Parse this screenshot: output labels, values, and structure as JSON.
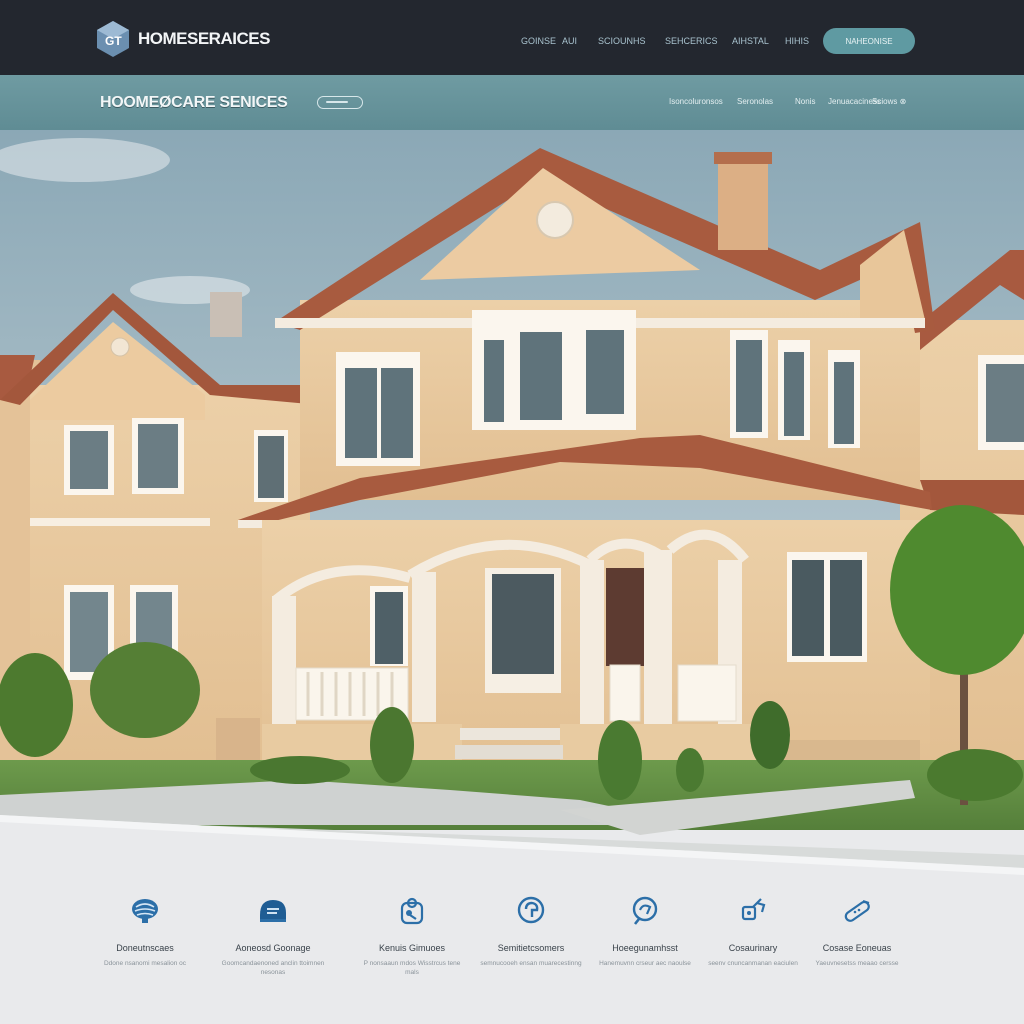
{
  "header": {
    "logo_text": "HOMESERAICES",
    "nav": [
      "GOINSE",
      "AUI",
      "SCIOUNHS",
      "SEHCERICS",
      "AIHSTAL",
      "HIHIS"
    ],
    "cta_label": "NAHEONISE"
  },
  "subheader": {
    "title": "HOOMEØCARE SENICES",
    "nav": [
      "Isoncoluronsos",
      "Seronolas",
      "Nonis",
      "Jenuacaciness",
      "Sciows ⊗"
    ]
  },
  "features": [
    {
      "icon": "brain-icon",
      "title": "Doneutnscaes",
      "desc": "Ddone nsanomi mesalion oc"
    },
    {
      "icon": "helmet-icon",
      "title": "Aoneosd Goonage",
      "desc": "Goomcandaenoned anclin ttoimnen nesonas"
    },
    {
      "icon": "hand-care-icon",
      "title": "Kenuis Gimuoes",
      "desc": "P nonsaaun mdos Wisstrcus tene mals"
    },
    {
      "icon": "ear-icon",
      "title": "Semitietcsomers",
      "desc": "semnucooeh ensan muarecestinng"
    },
    {
      "icon": "medical-search-icon",
      "title": "Hoeegunamhsst",
      "desc": "Hanemuvnn crseur aec naoulse"
    },
    {
      "icon": "tools-icon",
      "title": "Cosaurinary",
      "desc": "seenv cnuncanmanan eaciulen"
    },
    {
      "icon": "bandage-icon",
      "title": "Cosase Eoneuas",
      "desc": "Yaeuvnesetss meaao cersse"
    }
  ],
  "colors": {
    "topbar": "#23272f",
    "accent": "#5f9aa2",
    "subbar": "#6a969d",
    "icon_blue": "#2c6fa8"
  }
}
